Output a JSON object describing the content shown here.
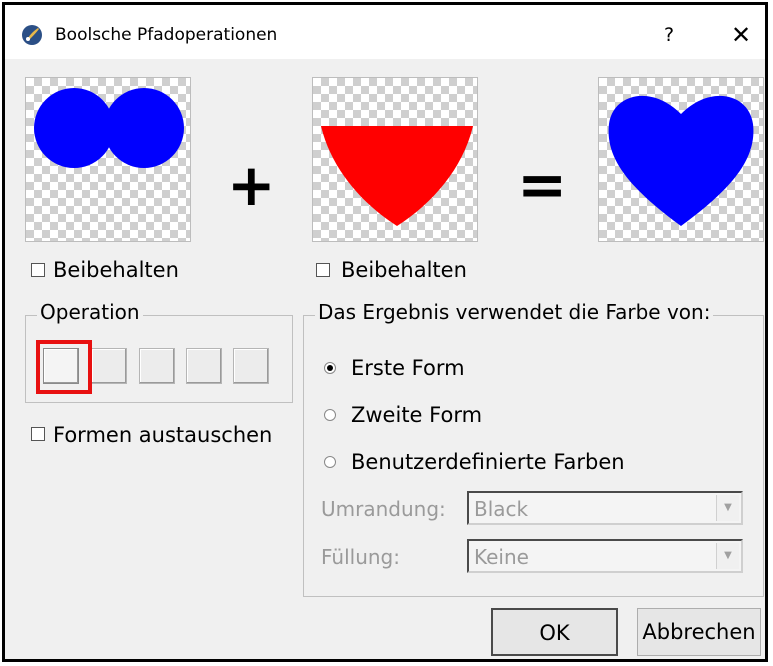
{
  "window": {
    "title": "Boolsche Pfadoperationen",
    "help_label": "?",
    "close_label": "✕"
  },
  "previews": {
    "first_shape_color": "#0000ff",
    "second_shape_color": "#ff0000",
    "result_shape_color": "#0000ff",
    "plus_sign": "+",
    "equals_sign": "="
  },
  "keep_first": {
    "label": "Beibehalten",
    "checked": false
  },
  "keep_second": {
    "label": "Beibehalten",
    "checked": false
  },
  "operation_group": {
    "title": "Operation",
    "buttons": [
      "",
      "",
      "",
      "",
      ""
    ],
    "selected_index": 0
  },
  "swap_shapes": {
    "label": "Formen austauschen",
    "checked": false
  },
  "color_group": {
    "title": "Das Ergebnis verwendet die Farbe von:",
    "options": [
      "Erste Form",
      "Zweite Form",
      "Benutzerdefinierte Farben"
    ],
    "selected_index": 0,
    "outline_label": "Umrandung:",
    "outline_value": "Black",
    "fill_label": "Füllung:",
    "fill_value": "Keine"
  },
  "buttons": {
    "ok": "OK",
    "cancel": "Abbrechen"
  },
  "colors": {
    "highlight": "#e81010",
    "dialog_bg": "#f0f0f0"
  }
}
